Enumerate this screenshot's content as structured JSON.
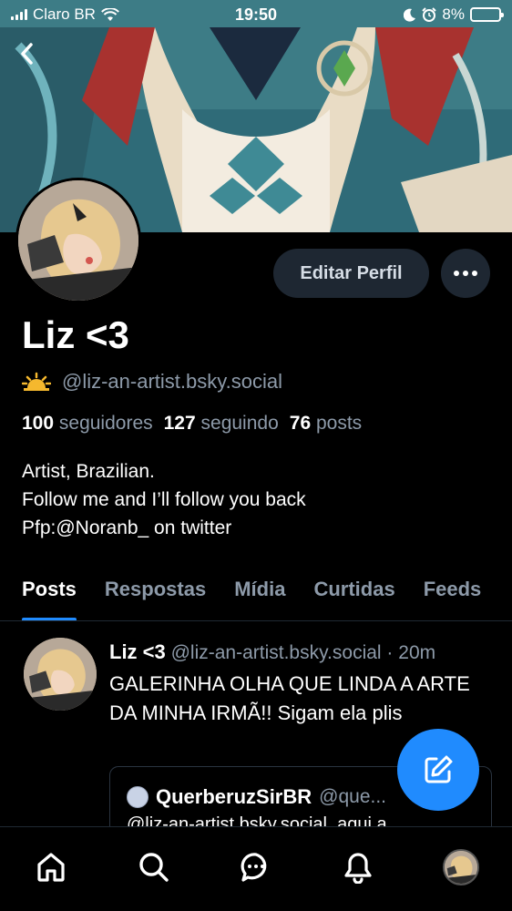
{
  "status_bar": {
    "carrier": "Claro BR",
    "time": "19:50",
    "battery": "8%",
    "battery_level": 0.08,
    "icons": [
      "signal-icon",
      "wifi-icon",
      "moon-icon",
      "alarm-icon",
      "battery-icon"
    ]
  },
  "header": {
    "back_icon": "chevron-left-icon"
  },
  "profile": {
    "display_name": "Liz <3",
    "handle": "@liz-an-artist.bsky.social",
    "handle_icon": "sun-emoji",
    "edit_button": "Editar Perfil",
    "more_icon": "more-dots-icon",
    "stats": {
      "followers_count": "100",
      "followers_label": "seguidores",
      "following_count": "127",
      "following_label": "seguindo",
      "posts_count": "76",
      "posts_label": "posts"
    },
    "bio": [
      "Artist, Brazilian.",
      "Follow me and I’ll follow you back",
      "Pfp:@Noranb_ on twitter"
    ]
  },
  "tabs": [
    {
      "label": "Posts",
      "active": true
    },
    {
      "label": "Respostas",
      "active": false
    },
    {
      "label": "Mídia",
      "active": false
    },
    {
      "label": "Curtidas",
      "active": false
    },
    {
      "label": "Feeds",
      "active": false
    }
  ],
  "post": {
    "author_name": "Liz <3",
    "author_handle": "@liz-an-artist.bsky.social",
    "separator": "·",
    "time": "20m",
    "text": "GALERINHA OLHA QUE LINDA A ARTE DA MINHA IRMÃ!! Sigam ela plis",
    "quote": {
      "author_name": "QuerberuzSirBR",
      "author_handle": "@que...",
      "text": "@liz-an-artist.bsky.social, aqui a"
    }
  },
  "fab": {
    "icon": "compose-icon"
  },
  "tab_bar": {
    "items": [
      "home-icon",
      "search-icon",
      "chat-icon",
      "bell-icon",
      "profile-avatar"
    ]
  },
  "colors": {
    "accent": "#208bfe",
    "background": "#000000",
    "muted_text": "#8d9aa9",
    "button_bg": "#1e2732"
  }
}
